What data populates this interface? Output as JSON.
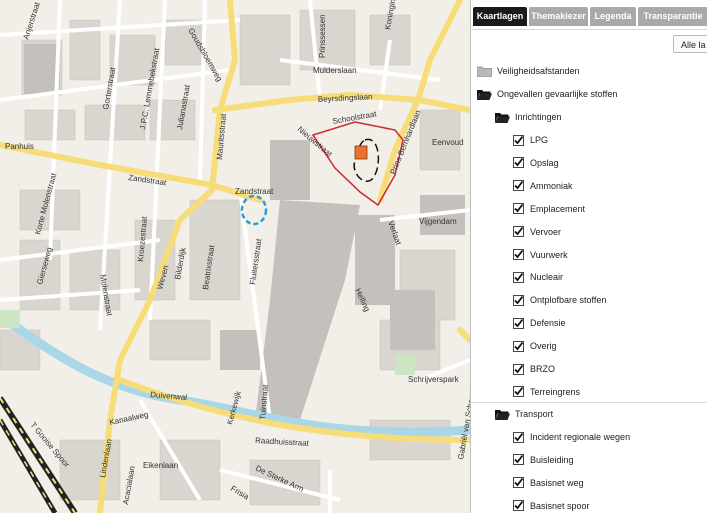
{
  "map": {
    "streets": [
      "Anjerstraat",
      "Goudsbloemweg",
      "Mulderslaan",
      "Prinssessen",
      "Koningin",
      "Prins Bernhardlaan",
      "Beyrsdingslaan",
      "Schoolstraat",
      "Nieuwstraat",
      "Eenvoud",
      "Panhuis",
      "Zandstraat",
      "Zandstraat",
      "Gorterstraat",
      "J.P.C. Lemmebekstraat",
      "Julianastraat",
      "Mauritsstraat",
      "Korte Molenstraat",
      "Gierseweg",
      "Molenstraat",
      "Kroezestraat",
      "Weven",
      "Bilderdijk",
      "Beatrixstraat",
      "Fluitersstraat",
      "Verlaat",
      "Vijgendam",
      "Helling",
      "Schrijverspark",
      "Duivenwal",
      "Kanaalweg",
      "Raadhuisstraat",
      "Kerkewijk",
      "Tuinstraat",
      "Lindenlaan",
      "Eikenlaan",
      "Acacialaan",
      "Frisia",
      "De Sterke Arm",
      "Gabriël van Schoonbeke",
      "T Gooise Spoor"
    ]
  },
  "tabs": [
    {
      "label": "Kaartlagen",
      "active": true
    },
    {
      "label": "Themakiezer",
      "active": false
    },
    {
      "label": "Legenda",
      "active": false
    },
    {
      "label": "Transparantie",
      "active": false
    }
  ],
  "all_button": "Alle la",
  "tree": {
    "veiligheid": "Veiligheidsafstanden",
    "ongevallen": "Ongevallen gevaarlijke stoffen",
    "inrichtingen": "Inrichtingen",
    "inrichtingen_items": [
      "LPG",
      "Opslag",
      "Ammoniak",
      "Emplacement",
      "Vervoer",
      "Vuurwerk",
      "Nucleair",
      "Ontplofbare stoffen",
      "Defensie",
      "Overig",
      "BRZO",
      "Terreingrens"
    ],
    "transport": "Transport",
    "transport_items": [
      "Incident regionale wegen",
      "Buisleiding",
      "Basisnet weg",
      "Basisnet spoor"
    ]
  },
  "colors": {
    "tab_active": "#1a1a1a",
    "tab_inactive": "#a9a9a9",
    "road_major": "#f7dc7a",
    "canal": "#a9d7e8",
    "hazard_outline": "#d0282f",
    "hazard_fill": "#ee7030",
    "buffer_blue": "#2e9bd6"
  }
}
